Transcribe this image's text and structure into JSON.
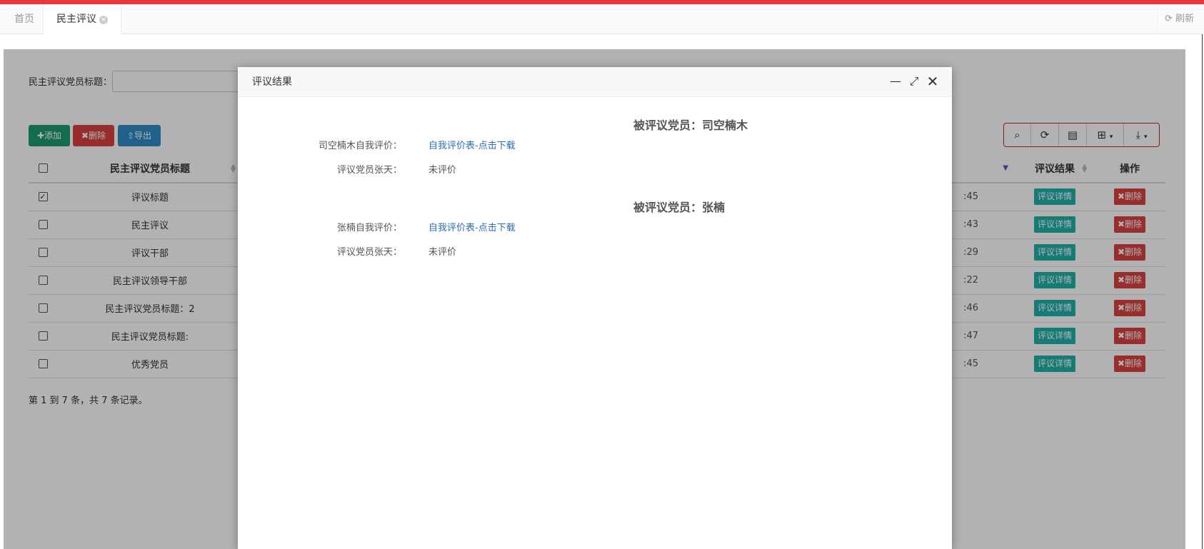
{
  "tabs": {
    "home": "首页",
    "active": "民主评议",
    "refresh": "刷新"
  },
  "search": {
    "label": "民主评议党员标题：",
    "value": ""
  },
  "toolbar": {
    "add": "添加",
    "delete": "删除",
    "export": "导出"
  },
  "table": {
    "headers": {
      "title": "民主评议党员标题",
      "result": "评议结果",
      "ops": "操作"
    },
    "rows": [
      {
        "title": "评议标题",
        "time": ":45",
        "checked": true
      },
      {
        "title": "民主评议",
        "time": ":43",
        "checked": false
      },
      {
        "title": "评议干部",
        "time": ":29",
        "checked": false
      },
      {
        "title": "民主评议领导干部",
        "time": ":22",
        "checked": false
      },
      {
        "title": "民主评议党员标题：2",
        "time": ":46",
        "checked": false
      },
      {
        "title": "民主评议党员标题:",
        "time": ":47",
        "checked": false
      },
      {
        "title": "优秀党员",
        "time": ":45",
        "checked": false
      }
    ],
    "detail_btn": "评议详情",
    "remove_btn": "删除"
  },
  "pager": "第 1 到 7 条，共 7 条记录。",
  "dialog": {
    "title": "评议结果",
    "sections": [
      {
        "member": "被评议党员：司空楠木",
        "self_label": "司空楠木自我评价：",
        "self_link": "自我评价表-点击下载",
        "reviewer_label": "评议党员张天：",
        "reviewer_value": "未评价"
      },
      {
        "member": "被评议党员：张楠",
        "self_label": "张楠自我评价：",
        "self_link": "自我评价表-点击下载",
        "reviewer_label": "评议党员张天：",
        "reviewer_value": "未评价"
      }
    ]
  }
}
